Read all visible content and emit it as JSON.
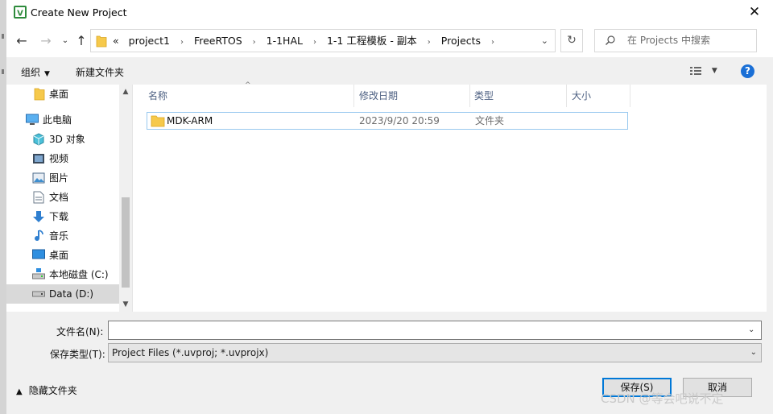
{
  "window": {
    "title": "Create New Project",
    "close_glyph": "✕"
  },
  "address_bar": {
    "overflow_glyph": "«",
    "crumbs": [
      "project1",
      "FreeRTOS",
      "1-1HAL",
      "1-1 工程模板 - 副本",
      "Projects"
    ],
    "separator": "›"
  },
  "search": {
    "placeholder": "在 Projects 中搜索"
  },
  "toolbar": {
    "organize_label": "组织",
    "new_folder_label": "新建文件夹",
    "help_glyph": "?"
  },
  "sidebar": {
    "items": [
      {
        "label": "桌面",
        "icon": "folder-icon"
      },
      {
        "label": "此电脑",
        "icon": "computer-icon"
      },
      {
        "label": "3D 对象",
        "icon": "cube-icon"
      },
      {
        "label": "视频",
        "icon": "video-icon"
      },
      {
        "label": "图片",
        "icon": "picture-icon"
      },
      {
        "label": "文档",
        "icon": "document-icon"
      },
      {
        "label": "下载",
        "icon": "download-icon"
      },
      {
        "label": "音乐",
        "icon": "music-icon"
      },
      {
        "label": "桌面",
        "icon": "desktop-icon"
      },
      {
        "label": "本地磁盘 (C:)",
        "icon": "disk-icon"
      },
      {
        "label": "Data (D:)",
        "icon": "drive-icon"
      }
    ]
  },
  "file_list": {
    "columns": [
      "名称",
      "修改日期",
      "类型",
      "大小"
    ],
    "rows": [
      {
        "name": "MDK-ARM",
        "modified": "2023/9/20 20:59",
        "type": "文件夹",
        "size": ""
      }
    ]
  },
  "form": {
    "filename_label": "文件名(N):",
    "filename_value": "",
    "filetype_label": "保存类型(T):",
    "filetype_value": "Project Files (*.uvproj; *.uvprojx)",
    "hide_folders_label": "隐藏文件夹",
    "save_label": "保存(S)",
    "cancel_label": "取消"
  },
  "watermark": "CSDN @等会吧说不定",
  "colors": {
    "accent": "#0078d7",
    "folder": "#f6c94b",
    "help": "#1a6fd6",
    "header_text": "#4d6082"
  }
}
